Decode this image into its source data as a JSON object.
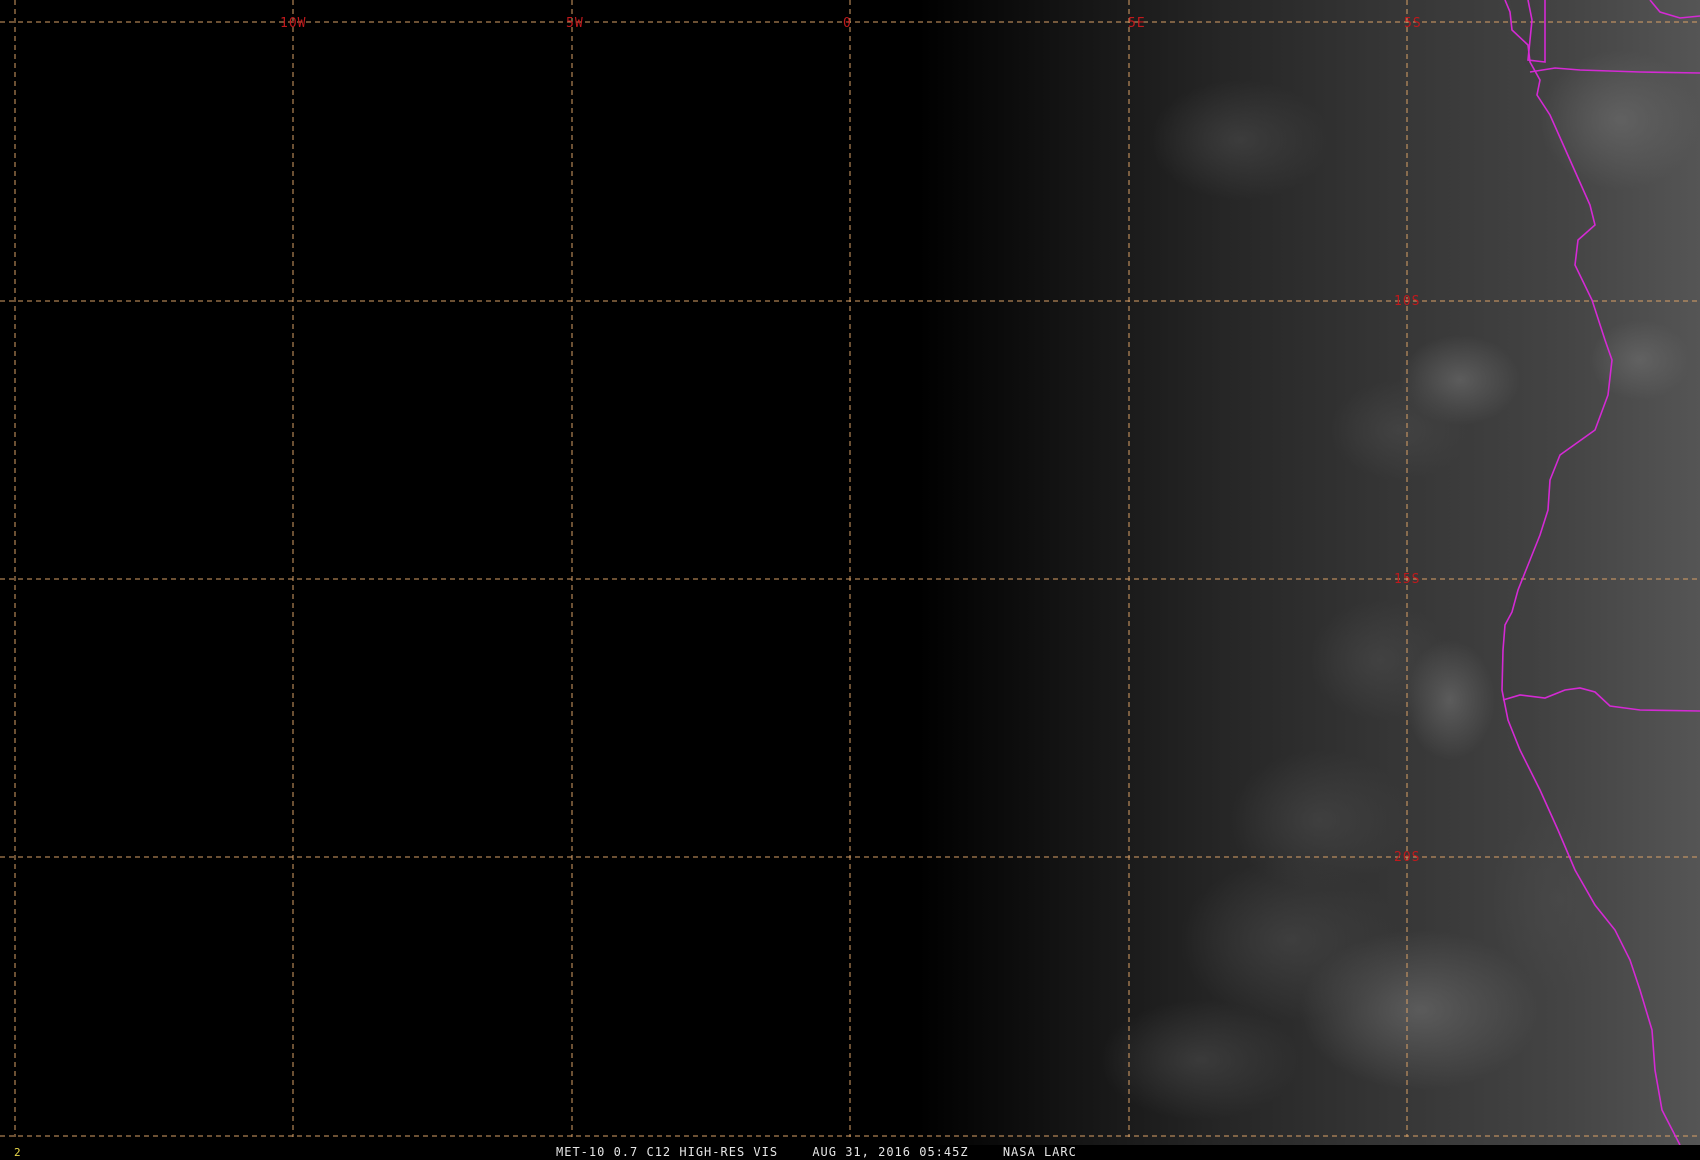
{
  "map": {
    "longitude_labels": [
      "10W",
      "5W",
      "0",
      "5E"
    ],
    "latitude_labels": [
      "5S",
      "10S",
      "15S",
      "20S"
    ],
    "grid_color": "#d9a066",
    "label_color": "#c0191c",
    "boundary_color": "#d42ad4",
    "grid_style": "dashed"
  },
  "status_bar": {
    "frame_number": "2",
    "product": "MET-10 0.7 C12 HIGH-RES VIS",
    "timestamp": "AUG 31, 2016 05:45Z",
    "source": "NASA LARC"
  }
}
